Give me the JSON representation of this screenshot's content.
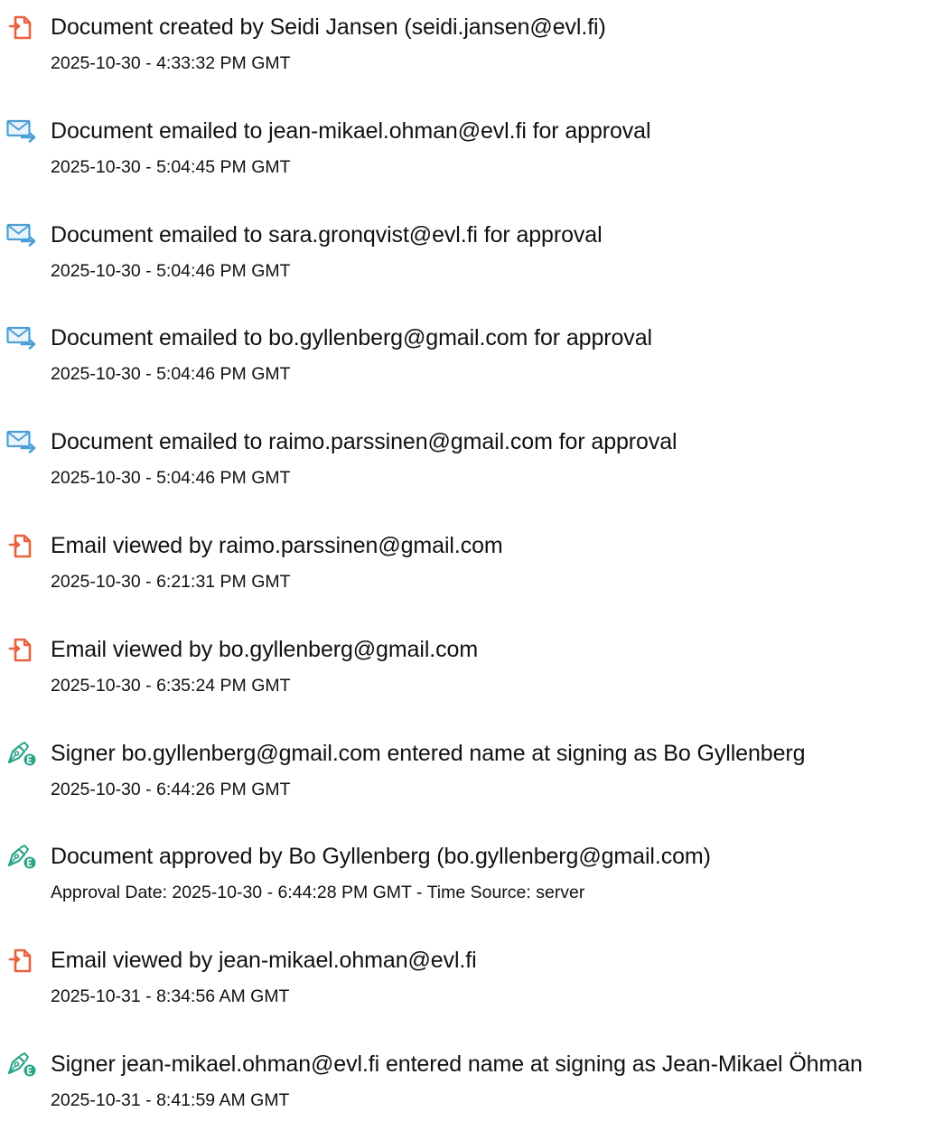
{
  "colors": {
    "document_icon": "#e8623d",
    "email_icon": "#4a9fd8",
    "signer_icon": "#2aa58a"
  },
  "events": [
    {
      "icon": "document-icon",
      "title": "Document created by Seidi Jansen (seidi.jansen@evl.fi)",
      "detail": "2025-10-30 - 4:33:32 PM GMT"
    },
    {
      "icon": "email-sent-icon",
      "title": "Document emailed to jean-mikael.ohman@evl.fi for approval",
      "detail": "2025-10-30 - 5:04:45 PM GMT"
    },
    {
      "icon": "email-sent-icon",
      "title": "Document emailed to sara.gronqvist@evl.fi for approval",
      "detail": "2025-10-30 - 5:04:46 PM GMT"
    },
    {
      "icon": "email-sent-icon",
      "title": "Document emailed to bo.gyllenberg@gmail.com for approval",
      "detail": "2025-10-30 - 5:04:46 PM GMT"
    },
    {
      "icon": "email-sent-icon",
      "title": "Document emailed to raimo.parssinen@gmail.com for approval",
      "detail": "2025-10-30 - 5:04:46 PM GMT"
    },
    {
      "icon": "document-icon",
      "title": "Email viewed by raimo.parssinen@gmail.com",
      "detail": "2025-10-30 - 6:21:31 PM GMT"
    },
    {
      "icon": "document-icon",
      "title": "Email viewed by bo.gyllenberg@gmail.com",
      "detail": "2025-10-30 - 6:35:24 PM GMT"
    },
    {
      "icon": "signer-pen-icon",
      "title": "Signer bo.gyllenberg@gmail.com entered name at signing as Bo Gyllenberg",
      "detail": "2025-10-30 - 6:44:26 PM GMT"
    },
    {
      "icon": "signer-pen-icon",
      "title": "Document approved by Bo Gyllenberg (bo.gyllenberg@gmail.com)",
      "detail": "Approval Date: 2025-10-30 - 6:44:28 PM GMT - Time Source: server"
    },
    {
      "icon": "document-icon",
      "title": "Email viewed by jean-mikael.ohman@evl.fi",
      "detail": "2025-10-31 - 8:34:56 AM GMT"
    },
    {
      "icon": "signer-pen-icon",
      "title": "Signer jean-mikael.ohman@evl.fi entered name at signing as Jean-Mikael Öhman",
      "detail": "2025-10-31 - 8:41:59 AM GMT"
    }
  ]
}
